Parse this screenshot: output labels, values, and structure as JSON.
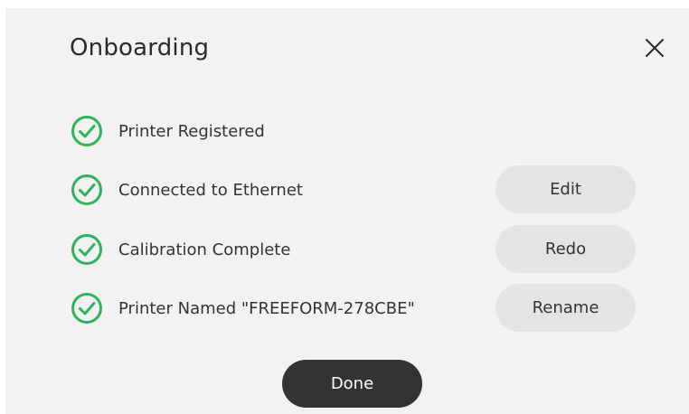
{
  "dialog": {
    "title": "Onboarding",
    "close_icon": "close-icon"
  },
  "steps": [
    {
      "label": "Printer Registered",
      "status": "complete",
      "icon": "check-circle-icon"
    },
    {
      "label": "Connected to Ethernet",
      "status": "complete",
      "icon": "check-circle-icon",
      "action_label": "Edit"
    },
    {
      "label": "Calibration Complete",
      "status": "complete",
      "icon": "check-circle-icon",
      "action_label": "Redo"
    },
    {
      "label": "Printer Named \"FREEFORM-278CBE\"",
      "status": "complete",
      "icon": "check-circle-icon",
      "action_label": "Rename"
    }
  ],
  "footer": {
    "done_label": "Done"
  },
  "colors": {
    "check_green": "#2fb35a",
    "dialog_bg": "#f2f2f2",
    "secondary_button": "#e4e4e4",
    "primary_button": "#333333"
  }
}
